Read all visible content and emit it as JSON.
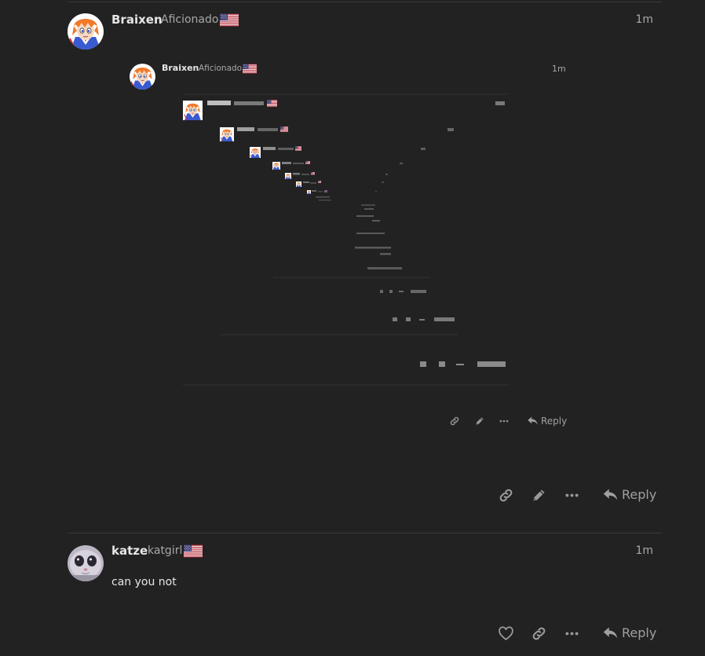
{
  "posts": [
    {
      "username": "Braixen",
      "user_title": "Aficionado",
      "flag": "us-flag-icon",
      "time": "1m",
      "reply_label": "Reply",
      "embedded_screenshot": {
        "username": "Braixen",
        "user_title": "Aficionado",
        "time": "1m",
        "reply_label": "Reply"
      }
    },
    {
      "username": "katze",
      "user_title": "katgirl",
      "flag": "us-flag-icon",
      "time": "1m",
      "body": "can you not",
      "reply_label": "Reply"
    }
  ],
  "icons": {
    "like": "heart-icon",
    "share": "link-icon",
    "edit": "pencil-icon",
    "more": "ellipsis-icon",
    "reply": "reply-arrow-icon"
  },
  "colors": {
    "background": "#222222",
    "text": "#dddddd",
    "muted": "#a8a8a8",
    "divider": "#3a3a3a",
    "avatar_braixen_hair": "#f07a2a",
    "avatar_katze": "#c9c3cf"
  }
}
